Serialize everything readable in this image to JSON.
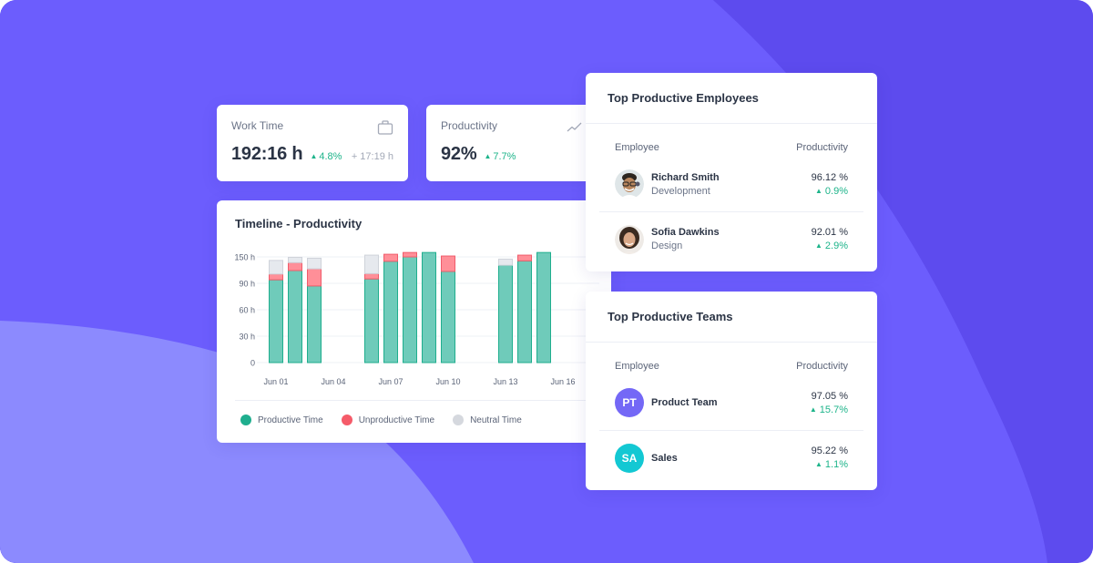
{
  "theme": {
    "productive": "#6fcbba",
    "productive_stroke": "#1fae8e",
    "unproductive": "#ff8f98",
    "unproductive_stroke": "#f05c6b",
    "neutral": "#e6e9ee",
    "neutral_stroke": "#cfd3da",
    "delta_positive": "#1db48a",
    "accent_purple": "#7468f6",
    "accent_teal": "#13c8d3"
  },
  "kpis": [
    {
      "title": "Work Time",
      "icon": "briefcase-icon",
      "value": "192:16 h",
      "delta": "4.8%",
      "extra": "+ 17:19 h"
    },
    {
      "title": "Productivity",
      "icon": "trend-line-icon",
      "value": "92%",
      "delta": "7.7%"
    }
  ],
  "chart_data": {
    "type": "bar",
    "stacked": true,
    "title": "Timeline - Productivity",
    "xlabel": "",
    "ylabel": "",
    "y_ticks": [
      0,
      30,
      60,
      90,
      150
    ],
    "y_tick_labels": [
      "0",
      "30 h",
      "60 h",
      "90 h",
      "150 h"
    ],
    "x_tick_labels": [
      "Jun 01",
      "Jun 04",
      "Jun 07",
      "Jun 10",
      "Jun 13",
      "Jun 16"
    ],
    "categories": [
      "Jun 01",
      "Jun 02",
      "Jun 03",
      "Jun 04",
      "Jun 05",
      "Jun 06",
      "Jun 07",
      "Jun 08",
      "Jun 09",
      "Jun 10",
      "Jun 11",
      "Jun 12",
      "Jun 13",
      "Jun 14",
      "Jun 15",
      "Jun 16"
    ],
    "series": [
      {
        "name": "Productive Time",
        "key": "productive",
        "values": [
          98,
          119,
          87,
          0,
          0,
          100,
          140,
          150,
          160,
          117,
          0,
          0,
          131,
          141,
          160,
          0
        ]
      },
      {
        "name": "Unproductive Time",
        "key": "unproductive",
        "values": [
          13,
          18,
          36,
          0,
          0,
          12,
          16,
          10,
          0,
          35,
          0,
          0,
          0,
          13,
          0,
          0
        ]
      },
      {
        "name": "Neutral Time",
        "key": "neutral",
        "values": [
          31,
          12,
          24,
          0,
          0,
          42,
          0,
          0,
          0,
          0,
          0,
          0,
          14,
          0,
          0,
          0
        ]
      }
    ],
    "grid": true,
    "legend_position": "bottom-left"
  },
  "legend": [
    {
      "label": "Productive Time",
      "color": "#1fae8e"
    },
    {
      "label": "Unproductive Time",
      "color": "#f55b69"
    },
    {
      "label": "Neutral Time",
      "color": "#d5d8de"
    }
  ],
  "employees": {
    "title": "Top Productive Employees",
    "col_name": "Employee",
    "col_value": "Productivity",
    "rows": [
      {
        "name": "Richard Smith",
        "department": "Development",
        "value": "96.12 %",
        "delta": "0.9%"
      },
      {
        "name": "Sofia Dawkins",
        "department": "Design",
        "value": "92.01 %",
        "delta": "2.9%"
      }
    ]
  },
  "teams": {
    "title": "Top Productive Teams",
    "col_name": "Employee",
    "col_value": "Productivity",
    "rows": [
      {
        "initials": "PT",
        "name": "Product Team",
        "value": "97.05 %",
        "delta": "15.7%"
      },
      {
        "initials": "SA",
        "name": "Sales",
        "value": "95.22 %",
        "delta": "1.1%"
      }
    ]
  },
  "delta_arrow": "▲"
}
